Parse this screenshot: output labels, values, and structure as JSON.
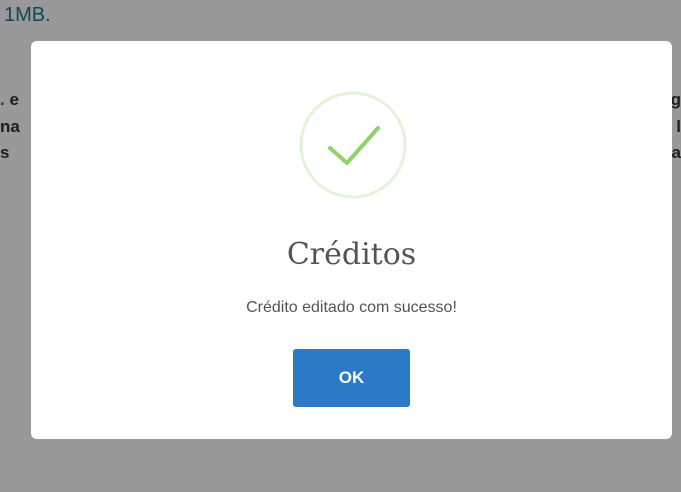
{
  "background": {
    "size_text": "1MB.",
    "left_fragments": [
      "e",
      "na",
      "s"
    ],
    "right_fragments": [
      "g",
      "l",
      "ja"
    ]
  },
  "dialog": {
    "icon": "success-check-icon",
    "title": "Créditos",
    "message": "Crédito editado com sucesso!",
    "ok_label": "OK",
    "accent_color": "#2a7ac8",
    "success_color": "#8fd16a"
  }
}
